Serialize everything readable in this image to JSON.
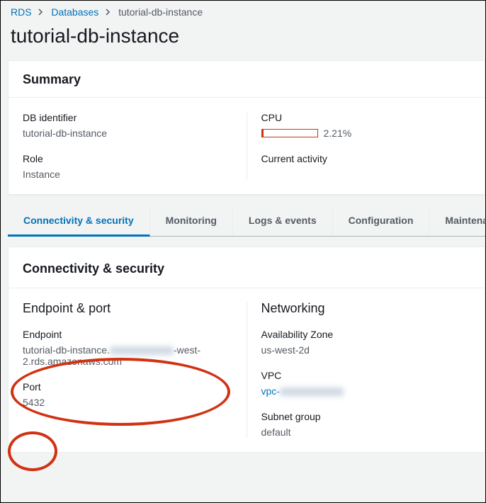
{
  "breadcrumb": {
    "root": "RDS",
    "parent": "Databases",
    "current": "tutorial-db-instance"
  },
  "page_title": "tutorial-db-instance",
  "summary": {
    "heading": "Summary",
    "db_identifier_label": "DB identifier",
    "db_identifier_value": "tutorial-db-instance",
    "role_label": "Role",
    "role_value": "Instance",
    "cpu_label": "CPU",
    "cpu_percent": "2.21%",
    "activity_label": "Current activity"
  },
  "tabs": {
    "connectivity": "Connectivity & security",
    "monitoring": "Monitoring",
    "logs": "Logs & events",
    "configuration": "Configuration",
    "maintenance": "Maintenanc"
  },
  "connectivity": {
    "heading": "Connectivity & security",
    "endpoint_section": "Endpoint & port",
    "endpoint_label": "Endpoint",
    "endpoint_value_prefix": "tutorial-db-instance.",
    "endpoint_value_suffix": "-west-2.rds.amazonaws.com",
    "port_label": "Port",
    "port_value": "5432",
    "networking_section": "Networking",
    "az_label": "Availability Zone",
    "az_value": "us-west-2d",
    "vpc_label": "VPC",
    "vpc_prefix": "vpc-",
    "subnet_label": "Subnet group",
    "subnet_value": "default"
  }
}
